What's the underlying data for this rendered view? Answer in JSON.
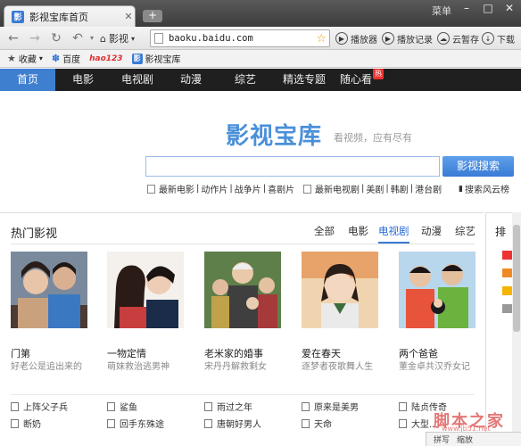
{
  "browser": {
    "tab_title": "影视宝库首页",
    "tab_favicon": "影",
    "new_tab": "+",
    "menu_label": "菜单",
    "nav": {
      "home_label": "影视",
      "url": "baoku.baidu.com"
    },
    "tools": [
      {
        "label": "播放器",
        "icon": "play-icon"
      },
      {
        "label": "播放记录",
        "icon": "history-icon"
      },
      {
        "label": "云暂存",
        "icon": "cloud-icon"
      },
      {
        "label": "下载",
        "icon": "download-icon"
      }
    ],
    "bookmarks": [
      {
        "label": "收藏",
        "icon": "star-icon"
      },
      {
        "label": "百度",
        "icon": "baidu-paw-icon"
      },
      {
        "label": "hao123",
        "icon": "hao123-icon"
      },
      {
        "label": "影视宝库",
        "icon": "baoku-icon"
      }
    ]
  },
  "site_nav": {
    "items": [
      "首页",
      "电影",
      "电视剧",
      "动漫",
      "综艺",
      "精选专题",
      "随心看"
    ],
    "hot_badge": "热"
  },
  "hero": {
    "logo": "影视宝库",
    "slogan": "看视频，应有尽有",
    "search_button": "影视搜索",
    "quick_links_left": [
      "最新电影",
      "动作片",
      "战争片",
      "喜剧片"
    ],
    "quick_links_right": [
      "最新电视剧",
      "美剧",
      "韩剧",
      "港台剧"
    ],
    "quick_links_far": "搜索风云榜"
  },
  "hot": {
    "title": "热门影视",
    "tabs": [
      "全部",
      "电影",
      "电视剧",
      "动漫",
      "综艺"
    ],
    "active_tab": "电视剧",
    "posters": [
      {
        "title": "门第",
        "desc": "好老公是追出来的"
      },
      {
        "title": "一物定情",
        "desc": "萌妹救治逃男神"
      },
      {
        "title": "老米家的婚事",
        "desc": "宋丹丹解救剩女"
      },
      {
        "title": "爱在春天",
        "desc": "逐梦者夜歌舞人生"
      },
      {
        "title": "两个爸爸",
        "desc": "董金卓共汉乔女记"
      }
    ],
    "list_row1": [
      "上阵父子兵",
      "鲨鱼",
      "雨过之年",
      "原来是美男",
      "陆贞传奇"
    ],
    "list_row2": [
      "断奶",
      "回手东殊途",
      "唐朝好男人",
      "天命",
      "大型..."
    ]
  },
  "right_panel": {
    "title": "排"
  },
  "statusbar": {
    "left": "拼写",
    "right": "缩放"
  },
  "watermark": {
    "main": "脚本之家",
    "sub": "www.jb51.net"
  },
  "colors": {
    "accent": "#3a7bd5",
    "nav_bg": "#1f1f1f",
    "watermark": "#e06060",
    "hot_badge": "#e33333"
  }
}
